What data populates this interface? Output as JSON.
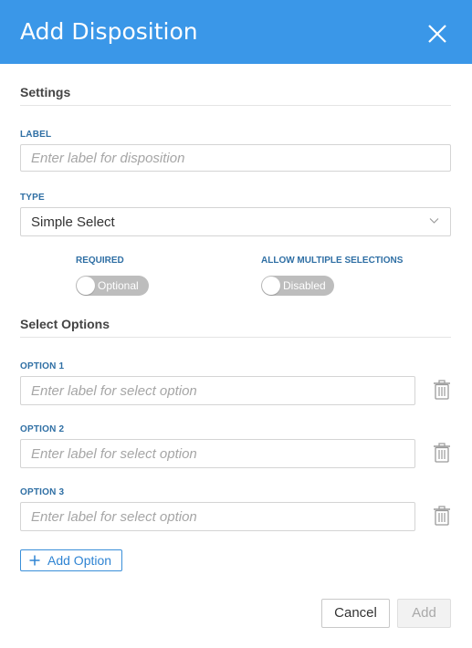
{
  "dialog": {
    "title": "Add Disposition",
    "close_icon": "close-icon"
  },
  "settings": {
    "section_title": "Settings",
    "label_field": {
      "label": "LABEL",
      "value": "",
      "placeholder": "Enter label for disposition"
    },
    "type_field": {
      "label": "TYPE",
      "selected": "Simple Select",
      "icon": "chevron-down-icon"
    },
    "required_toggle": {
      "label": "REQUIRED",
      "state_text": "Optional",
      "on": false
    },
    "multiple_toggle": {
      "label": "ALLOW MULTIPLE SELECTIONS",
      "state_text": "Disabled",
      "on": false
    }
  },
  "select_options": {
    "section_title": "Select Options",
    "options": [
      {
        "label": "OPTION 1",
        "value": "",
        "placeholder": "Enter label for select option"
      },
      {
        "label": "OPTION 2",
        "value": "",
        "placeholder": "Enter label for select option"
      },
      {
        "label": "OPTION 3",
        "value": "",
        "placeholder": "Enter label for select option"
      }
    ],
    "delete_icon": "trash-icon",
    "add_option_label": "Add Option",
    "add_icon": "plus-icon"
  },
  "footer": {
    "cancel_label": "Cancel",
    "add_label": "Add",
    "add_disabled": true
  },
  "colors": {
    "header": "#3a97e8",
    "field_label": "#2f6fa4",
    "link": "#2f84d3",
    "toggle_off": "#bdbdbd"
  }
}
